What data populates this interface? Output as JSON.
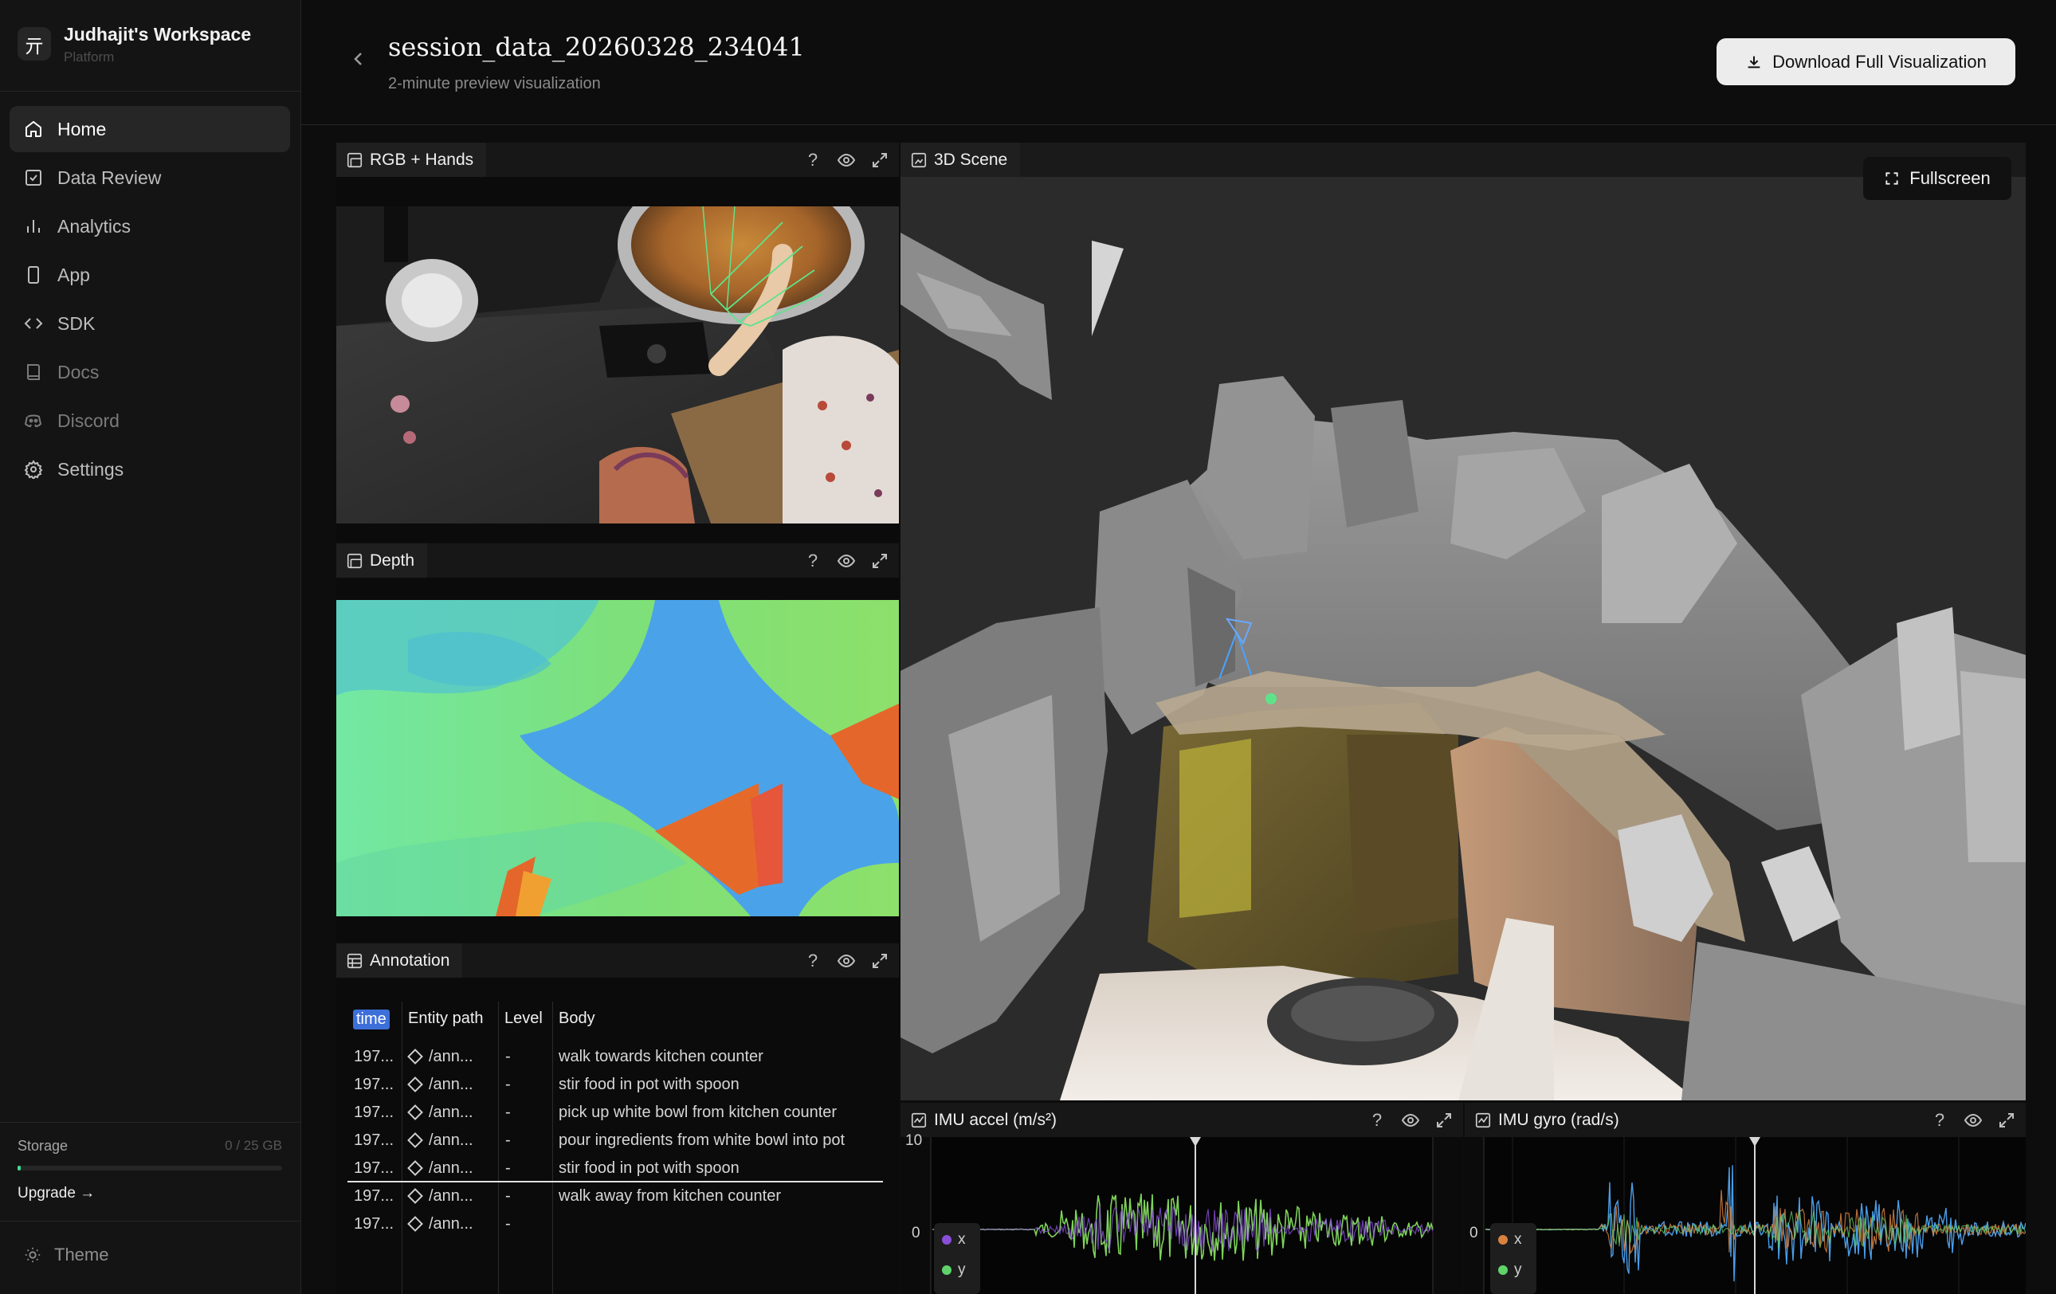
{
  "workspace": {
    "logo": "亓",
    "name": "Judhajit's Workspace",
    "sub": "Platform"
  },
  "nav": [
    {
      "label": "Home",
      "icon": "home-icon"
    },
    {
      "label": "Data Review",
      "icon": "checkbox-icon"
    },
    {
      "label": "Analytics",
      "icon": "bar-chart-icon"
    },
    {
      "label": "App",
      "icon": "phone-icon"
    },
    {
      "label": "SDK",
      "icon": "code-icon"
    },
    {
      "label": "Docs",
      "icon": "book-icon"
    },
    {
      "label": "Discord",
      "icon": "discord-icon"
    },
    {
      "label": "Settings",
      "icon": "gear-icon"
    }
  ],
  "storage": {
    "label": "Storage",
    "value": "0 / 25 GB",
    "upgrade": "Upgrade →",
    "fraction": 0.0
  },
  "theme": {
    "label": "Theme"
  },
  "header": {
    "title": "session_data_20260328_234041",
    "subtitle": "2-minute preview visualization",
    "download": "Download Full Visualization"
  },
  "panels": {
    "rgb": {
      "title": "RGB + Hands"
    },
    "depth": {
      "title": "Depth"
    },
    "annotation": {
      "title": "Annotation"
    },
    "scene": {
      "title": "3D Scene",
      "fullscreen": "Fullscreen"
    },
    "imu_accel": {
      "title": "IMU accel (m/s²)",
      "ytick_top": "10",
      "ytick_zero": "0",
      "legend": [
        "x",
        "y"
      ]
    },
    "imu_gyro": {
      "title": "IMU gyro (rad/s)",
      "ytick_zero": "0",
      "legend": [
        "x",
        "y"
      ]
    }
  },
  "tool_labels": {
    "help": "?"
  },
  "annotation": {
    "columns": [
      "time",
      "Entity path",
      "Level",
      "Body"
    ],
    "rows": [
      {
        "time": "197...",
        "entity": "/ann...",
        "level": "-",
        "body": "walk towards kitchen counter"
      },
      {
        "time": "197...",
        "entity": "/ann...",
        "level": "-",
        "body": "stir food in pot with spoon"
      },
      {
        "time": "197...",
        "entity": "/ann...",
        "level": "-",
        "body": "pick up white bowl from kitchen counter"
      },
      {
        "time": "197...",
        "entity": "/ann...",
        "level": "-",
        "body": "pour ingredients from white bowl into pot"
      },
      {
        "time": "197...",
        "entity": "/ann...",
        "level": "-",
        "body": "stir food in pot with spoon"
      },
      {
        "time": "197...",
        "entity": "/ann...",
        "level": "-",
        "body": "walk away from kitchen counter"
      },
      {
        "time": "197...",
        "entity": "/ann...",
        "level": "-",
        "body": ""
      }
    ]
  },
  "colors": {
    "accent": "#3d6fd9",
    "accel_x": "#8a4fd8",
    "accel_y": "#5fd36a",
    "gyro_x": "#d9823f",
    "gyro_y": "#5fd36a"
  }
}
